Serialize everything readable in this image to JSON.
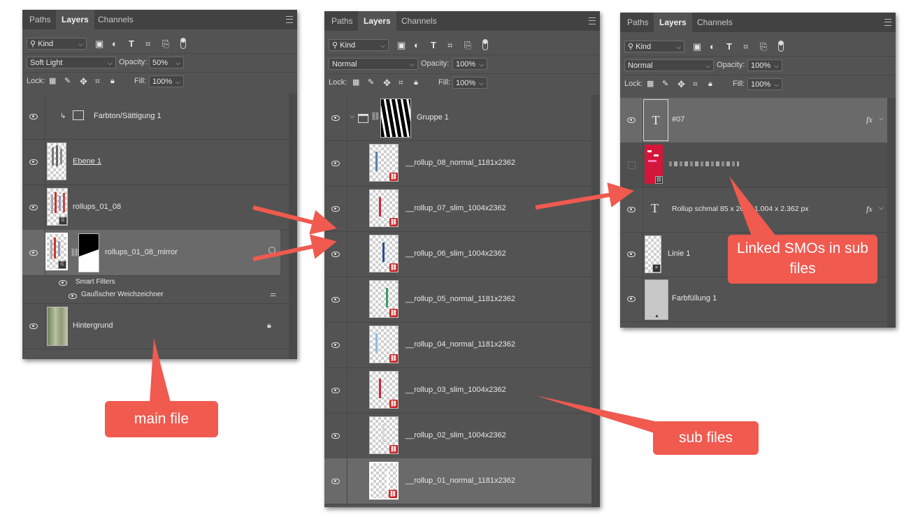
{
  "main_panel": {
    "tabs": [
      "Paths",
      "Layers",
      "Channels"
    ],
    "active_tab": "Layers",
    "filter_kind": "Kind",
    "blend_mode": "Soft Light",
    "opacity_label": "Opacity:",
    "opacity": "50%",
    "lock_label": "Lock:",
    "fill_label": "Fill:",
    "fill": "100%",
    "layers": [
      {
        "name": "Farbton/Sättigung 1"
      },
      {
        "name": "Ebene 1"
      },
      {
        "name": "rollups_01_08"
      },
      {
        "name": "rollups_01_08_mirror"
      },
      {
        "name": "Hintergrund"
      }
    ],
    "smart_filters_label": "Smart Filters",
    "smart_filter": "Gaußscher Weichzeichner"
  },
  "sub_panel": {
    "tabs": [
      "Paths",
      "Layers",
      "Channels"
    ],
    "active_tab": "Layers",
    "filter_kind": "Kind",
    "blend_mode": "Normal",
    "opacity_label": "Opacity:",
    "opacity": "100%",
    "lock_label": "Lock:",
    "fill_label": "Fill:",
    "fill": "100%",
    "group_name": "Gruppe 1",
    "layers": [
      {
        "name": "__rollup_08_normal_1181x2362"
      },
      {
        "name": "__rollup_07_slim_1004x2362"
      },
      {
        "name": "__rollup_06_slim_1004x2362"
      },
      {
        "name": "__rollup_05_normal_1181x2362"
      },
      {
        "name": "__rollup_04_normal_1181x2362"
      },
      {
        "name": "__rollup_03_slim_1004x2362"
      },
      {
        "name": "__rollup_02_slim_1004x2362"
      },
      {
        "name": "__rollup_01_normal_1181x2362"
      }
    ]
  },
  "smo_panel": {
    "tabs": [
      "Paths",
      "Layers",
      "Channels"
    ],
    "active_tab": "Layers",
    "filter_kind": "Kind",
    "blend_mode": "Normal",
    "opacity_label": "Opacity:",
    "opacity": "100%",
    "lock_label": "Lock:",
    "fill_label": "Fill:",
    "fill": "100%",
    "layers": [
      {
        "name": "#07",
        "fx": "fx"
      },
      {
        "name": "",
        "fx": ""
      },
      {
        "name": "Rollup schmal  85 x 200 / 1.004 x 2.362 px",
        "fx": "fx"
      },
      {
        "name": "Linie 1",
        "fx": ""
      },
      {
        "name": "Farbfüllung 1",
        "fx": ""
      }
    ]
  },
  "annotations": {
    "main_file": "main file",
    "sub_files": "sub files",
    "linked_smos": "Linked SMOs in sub files"
  },
  "colors": {
    "panel_bg": "#535353",
    "callout": "#f05a4f"
  }
}
